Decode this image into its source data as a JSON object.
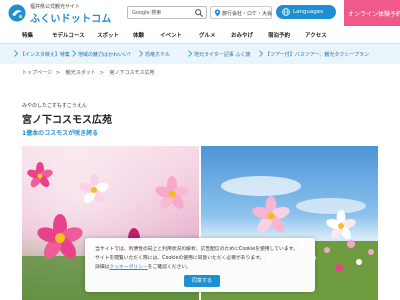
{
  "header": {
    "logo_sub": "福井県公式観光サイト",
    "logo_main": "ふくいドットコム",
    "search_placeholder": "Google 検索",
    "trip_select": "旅行会社・ロケ・大会",
    "language_label": "Languages",
    "reserve_label": "オンライン体験予約"
  },
  "nav": {
    "items": [
      "特集",
      "モデルコース",
      "スポット",
      "体験",
      "イベント",
      "グルメ",
      "おみやげ",
      "宿泊予約",
      "アクセス"
    ]
  },
  "ticker": {
    "items": [
      "【インスタ映え】特集",
      "地域の魅力はかわいい？",
      "恐竜ホテル",
      "地元ライター記事 ふく旅",
      "【ツアー付】バスツアー、観光タクシープラン"
    ]
  },
  "breadcrumb": [
    "トップページ",
    "観光スポット",
    "宮ノ下コスモス広苑"
  ],
  "spot": {
    "kana": "みやのしたこすもすこうえん",
    "title": "宮ノ下コスモス広苑",
    "subtitle": "1億本のコスモスが咲き誇る"
  },
  "cookie": {
    "line1": "当サイトでは、利便性の向上と利用状況の解析、広告配信のためにCookieを使用しています。",
    "line2": "サイトを閲覧いただく際には、Cookieの使用に同意いただく必要があります。",
    "line3_pre": "詳細は",
    "link": "クッキーポリシー",
    "line3_post": "をご確認ください。",
    "agree": "同意する"
  },
  "colors": {
    "accent": "#1e8fd1",
    "reserve": "#ef5a8a",
    "ticker_bg": "#eaf4fb"
  }
}
